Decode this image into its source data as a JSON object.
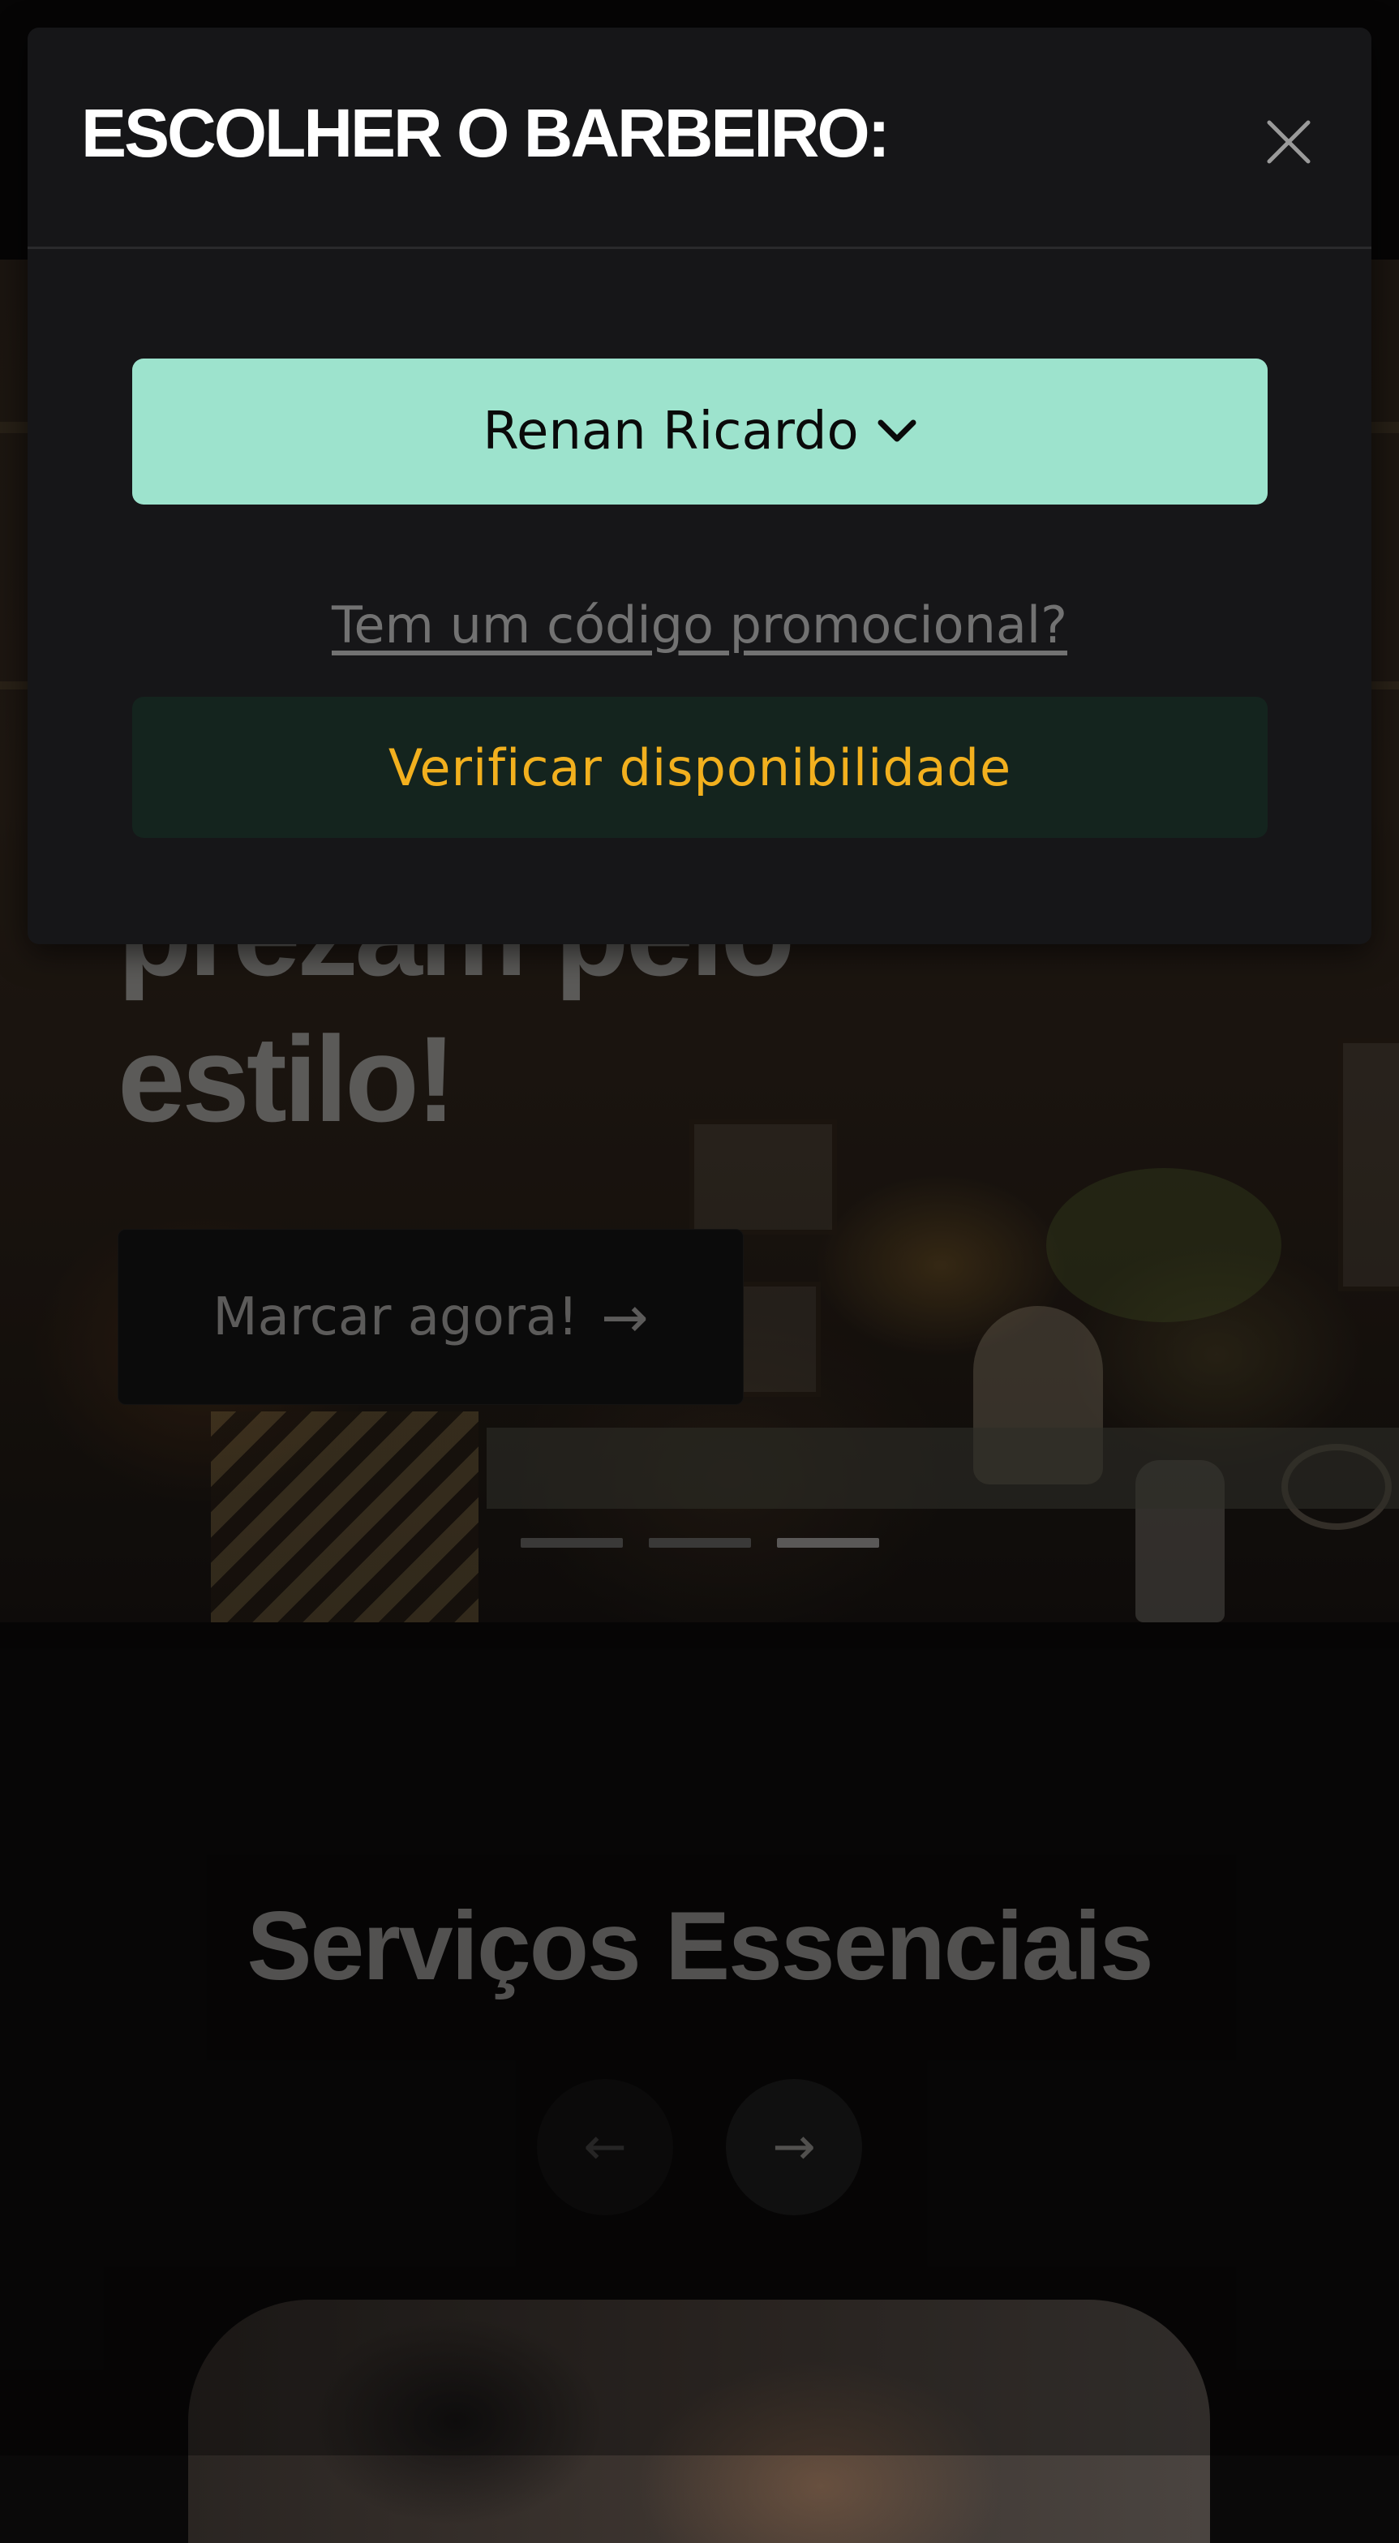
{
  "hero": {
    "heading": "prezam pelo\nestilo!",
    "cta_label": "Marcar agora!",
    "cta_icon": "arrow-right-icon",
    "slides": {
      "count": 3,
      "active": 3
    }
  },
  "services": {
    "title": "Serviços Essenciais",
    "prev_icon": "arrow-left-icon",
    "next_icon": "arrow-right-icon"
  },
  "modal": {
    "title": "ESCOLHER O BARBEIRO:",
    "close_icon": "close-icon",
    "barber_select": {
      "value": "Renan Ricardo",
      "icon": "chevron-down-icon"
    },
    "promo_link": "Tem um código promocional?",
    "check_button": "Verificar disponibilidade"
  },
  "colors": {
    "accent_mint": "#9de3cd",
    "accent_gold": "#f2b01e",
    "modal_bg": "#161618",
    "check_button_bg": "#14241e"
  }
}
